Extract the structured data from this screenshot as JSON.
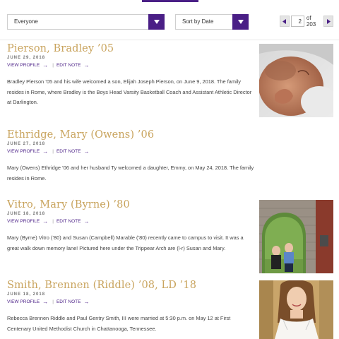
{
  "colors": {
    "accent": "#4a1f86",
    "name_gold": "#c9a45e"
  },
  "filters": {
    "audience": {
      "selected": "Everyone"
    },
    "sort": {
      "selected": "Sort by Date"
    }
  },
  "pagination": {
    "current_page": "2",
    "of_label": "of 203"
  },
  "entries": [
    {
      "name": "Pierson, Bradley ’05",
      "date": "JUNE 29, 2018",
      "view_profile": "VIEW PROFILE",
      "edit_note": "EDIT NOTE",
      "body": "Bradley Pierson ’05 and his wife welcomed a son, Elijah Joseph Pierson, on June 9, 2018.  The family resides in Rome, where Bradley is the Boys Head Varsity Basketball Coach and Assistant Athletic Director at Darlington."
    },
    {
      "name": "Ethridge, Mary (Owens) ’06",
      "date": "JUNE 27, 2018",
      "view_profile": "VIEW PROFILE",
      "edit_note": "EDIT NOTE",
      "body": "Mary (Owens) Ethridge ’06 and her husband Ty welcomed a daughter, Emmy, on May 24, 2018.  The family resides in Rome."
    },
    {
      "name": "Vitro, Mary (Byrne) ’80",
      "date": "JUNE 18, 2018",
      "view_profile": "VIEW PROFILE",
      "edit_note": "EDIT NOTE",
      "body": "Mary (Byrne) Vitro (’80) and Susan (Campbell) Marable (’80) recently came to campus to visit.  It was a great walk down memory lane!  Pictured here under the Trippear Arch are (l-r) Susan and Mary."
    },
    {
      "name": "Smith, Brennen (Riddle) ’08, LD ’18",
      "date": "JUNE 18, 2018",
      "view_profile": "VIEW PROFILE",
      "edit_note": "EDIT NOTE",
      "body": "Rebecca Brennen Riddle and Paul Gentry Smith, III were married at 5:30 p.m. on May 12 at First Centenary United Methodist Church in Chattanooga, Tennessee."
    }
  ]
}
